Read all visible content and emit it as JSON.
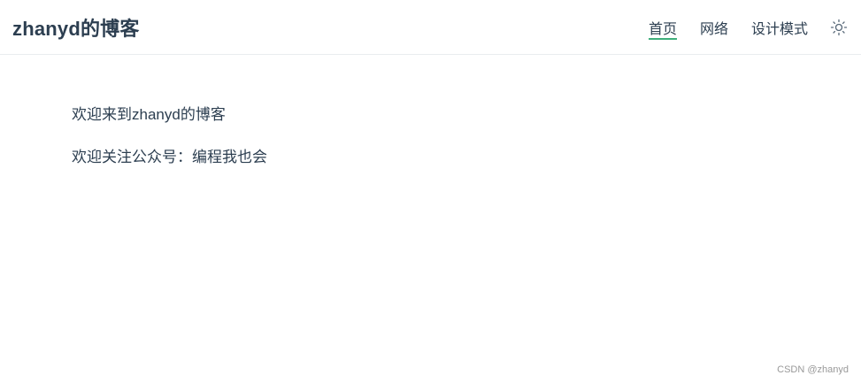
{
  "header": {
    "site_title": "zhanyd的博客",
    "nav": [
      {
        "label": "首页",
        "active": true
      },
      {
        "label": "网络",
        "active": false
      },
      {
        "label": "设计模式",
        "active": false
      }
    ],
    "theme_toggle_icon": "sun-icon"
  },
  "main": {
    "paragraphs": [
      "欢迎来到zhanyd的博客",
      "欢迎关注公众号：编程我也会"
    ]
  },
  "footer": {
    "watermark": "CSDN @zhanyd"
  },
  "colors": {
    "accent": "#3eaf7c",
    "text": "#2c3e50",
    "border": "#e9ecef"
  }
}
